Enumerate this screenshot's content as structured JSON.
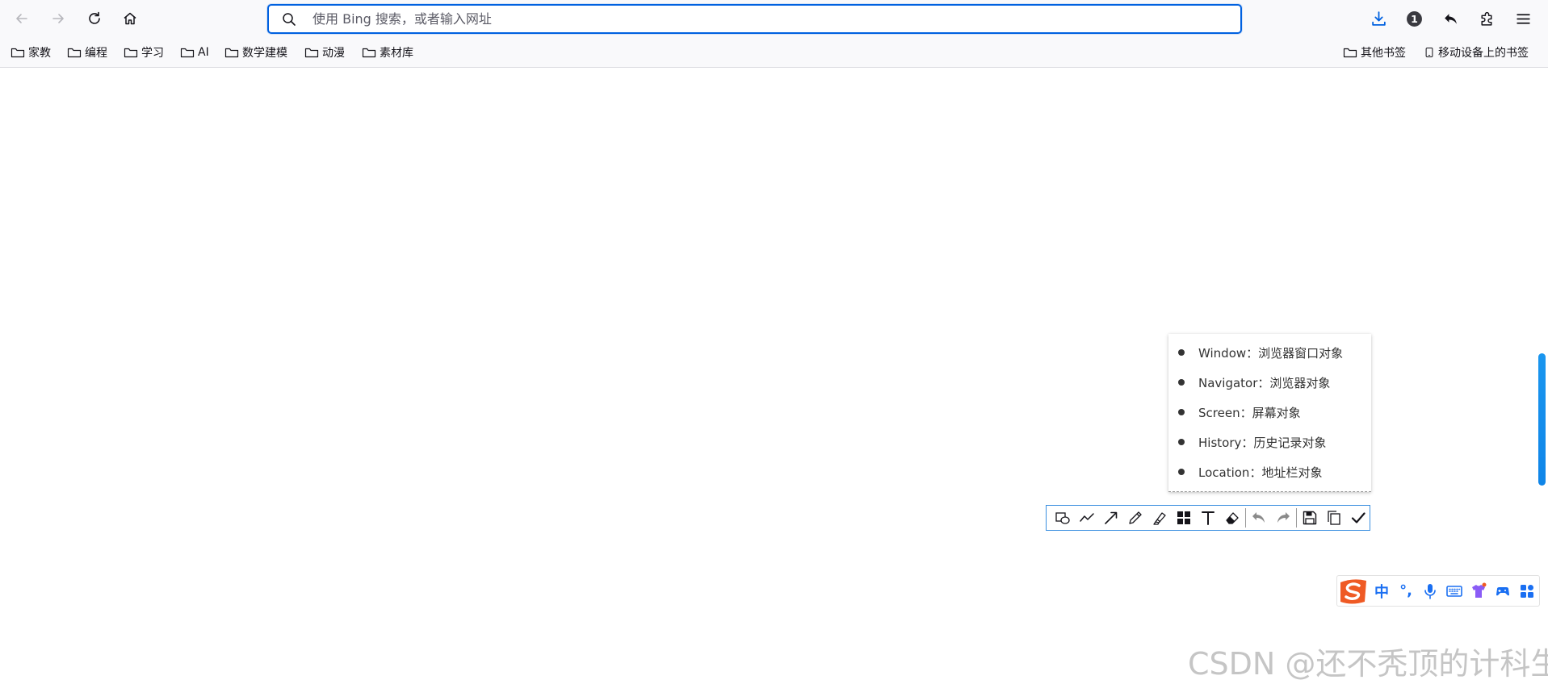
{
  "browser": {
    "urlbar": {
      "placeholder": "使用 Bing 搜索，或者输入网址"
    },
    "nav": {
      "back": "back-arrow-icon",
      "forward": "forward-arrow-icon",
      "reload": "reload-icon",
      "home": "home-icon"
    },
    "right_toolbar": {
      "badge_count": "1"
    }
  },
  "bookmarks": {
    "left": [
      "家教",
      "编程",
      "学习",
      "AI",
      "数学建模",
      "动漫",
      "素材库"
    ],
    "other": "其他书签",
    "mobile": "移动设备上的书签"
  },
  "list": {
    "items": [
      "Window：浏览器窗口对象",
      "Navigator：浏览器对象",
      "Screen：屏幕对象",
      "History：历史记录对象",
      "Location：地址栏对象"
    ]
  },
  "snip_toolbar": {
    "tools": [
      "rectangle-ellipse",
      "polyline",
      "arrow",
      "pencil",
      "highlighter",
      "mosaic",
      "text",
      "eraser",
      "undo",
      "redo",
      "save",
      "copy",
      "confirm"
    ]
  },
  "ime": {
    "lang": "中",
    "punct": "°,"
  },
  "watermark": "CSDN @还不秃顶的计科生",
  "colors": {
    "accent": "#0061e0",
    "ime_blue": "#1a6ff2",
    "sogou_orange": "#ef5a24",
    "scroll_blue": "#1a96ef"
  }
}
